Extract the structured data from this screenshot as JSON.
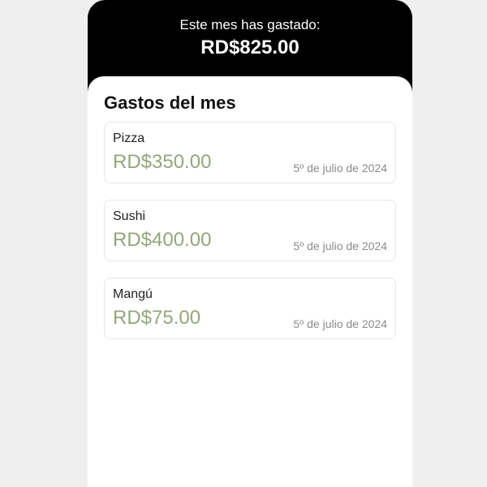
{
  "summary": {
    "caption": "Este mes has gastado:",
    "total": "RD$825.00"
  },
  "expenses": {
    "title": "Gastos del mes",
    "items": [
      {
        "name": "Pizza",
        "amount": "RD$350.00",
        "date": "5º de julio de 2024"
      },
      {
        "name": "Sushi",
        "amount": "RD$400.00",
        "date": "5º de julio de 2024"
      },
      {
        "name": "Mangú",
        "amount": "RD$75.00",
        "date": "5º de julio de 2024"
      }
    ]
  },
  "colors": {
    "background": "#efefef",
    "header": "#000000",
    "amount": "#94a67a",
    "date": "#8a8a8a",
    "card_border": "#e6e6e6"
  }
}
